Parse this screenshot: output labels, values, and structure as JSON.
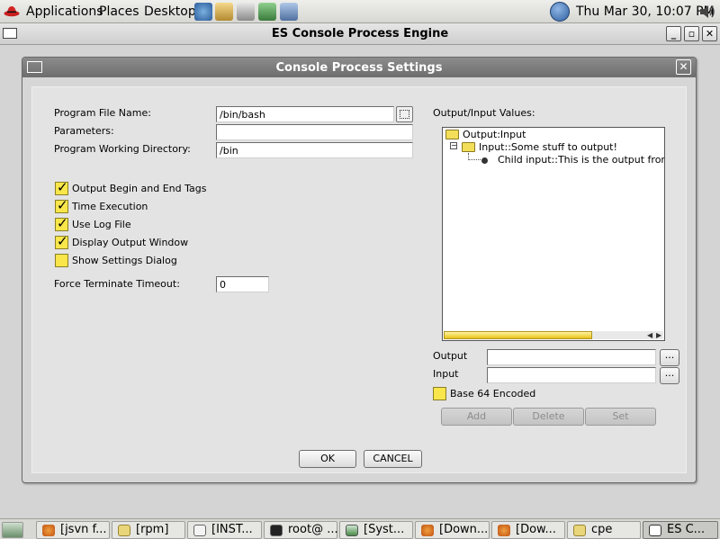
{
  "panel": {
    "menus": [
      "Applications",
      "Places",
      "Desktop"
    ],
    "clock": "Thu Mar 30, 10:07 PM"
  },
  "window": {
    "title": "ES Console Process Engine"
  },
  "dialog": {
    "title": "Console Process Settings",
    "program_file_label": "Program File Name:",
    "program_file_value": "/bin/bash",
    "parameters_label": "Parameters:",
    "parameters_value": "",
    "working_dir_label": "Program Working Directory:",
    "working_dir_value": "/bin",
    "checkboxes": [
      {
        "label": "Output Begin and End Tags",
        "checked": true
      },
      {
        "label": "Time Execution",
        "checked": true
      },
      {
        "label": "Use Log File",
        "checked": true
      },
      {
        "label": "Display Output Window",
        "checked": true
      },
      {
        "label": "Show Settings Dialog",
        "checked": false
      }
    ],
    "timeout_label": "Force Terminate Timeout:",
    "timeout_value": "0",
    "output_input_label": "Output/Input Values:",
    "tree": {
      "root": "Output:Input",
      "child": "Input::Some stuff to output!",
      "grandchild": "Child input::This is the output from"
    },
    "output_label": "Output",
    "output_value": "",
    "input_label": "Input",
    "input_value": "",
    "ellipsis": "...",
    "base64_label": "Base 64 Encoded",
    "base64_checked": false,
    "add_label": "Add",
    "delete_label": "Delete",
    "set_label": "Set",
    "ok_label": "OK",
    "cancel_label": "CANCEL"
  },
  "taskbar": {
    "items": [
      {
        "label": "[jsvn f...",
        "icon": "firefox-icon"
      },
      {
        "label": "[rpm]",
        "icon": "folder-icon"
      },
      {
        "label": "[INST...",
        "icon": "editor-icon"
      },
      {
        "label": "root@ ...",
        "icon": "terminal-icon"
      },
      {
        "label": "[Syst...",
        "icon": "system-monitor-icon"
      },
      {
        "label": "[Down...",
        "icon": "firefox-icon"
      },
      {
        "label": "[Dow...",
        "icon": "firefox-icon"
      },
      {
        "label": "cpe",
        "icon": "folder-icon"
      },
      {
        "label": "ES C...",
        "icon": "window-icon"
      }
    ]
  }
}
